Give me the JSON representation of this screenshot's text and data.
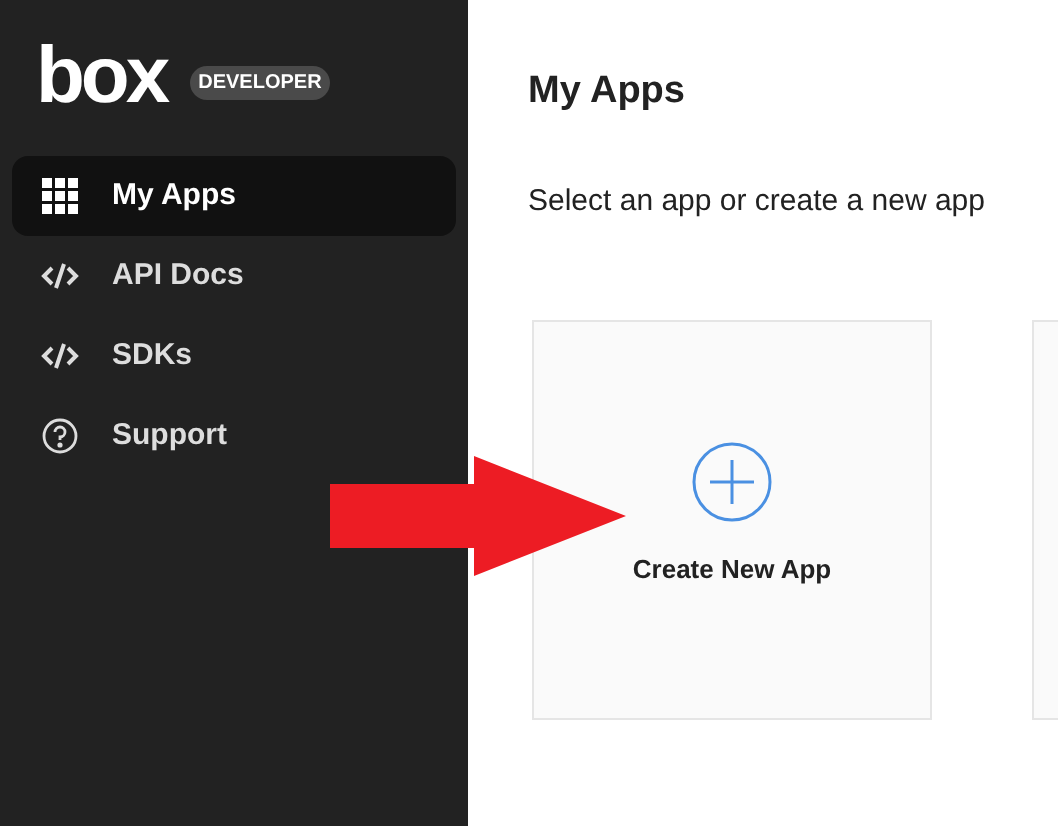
{
  "logo": {
    "wordmark": "box",
    "badge": "DEVELOPER"
  },
  "sidebar": {
    "items": [
      {
        "label": "My Apps",
        "kind": "grid",
        "selected": true
      },
      {
        "label": "API Docs",
        "kind": "code",
        "selected": false
      },
      {
        "label": "SDKs",
        "kind": "code",
        "selected": false
      },
      {
        "label": "Support",
        "kind": "help",
        "selected": false
      }
    ]
  },
  "main": {
    "title": "My Apps",
    "subtitle": "Select an app or create a new app",
    "cards": [
      {
        "kind": "create",
        "label": "Create New App"
      },
      {
        "kind": "app"
      }
    ]
  }
}
